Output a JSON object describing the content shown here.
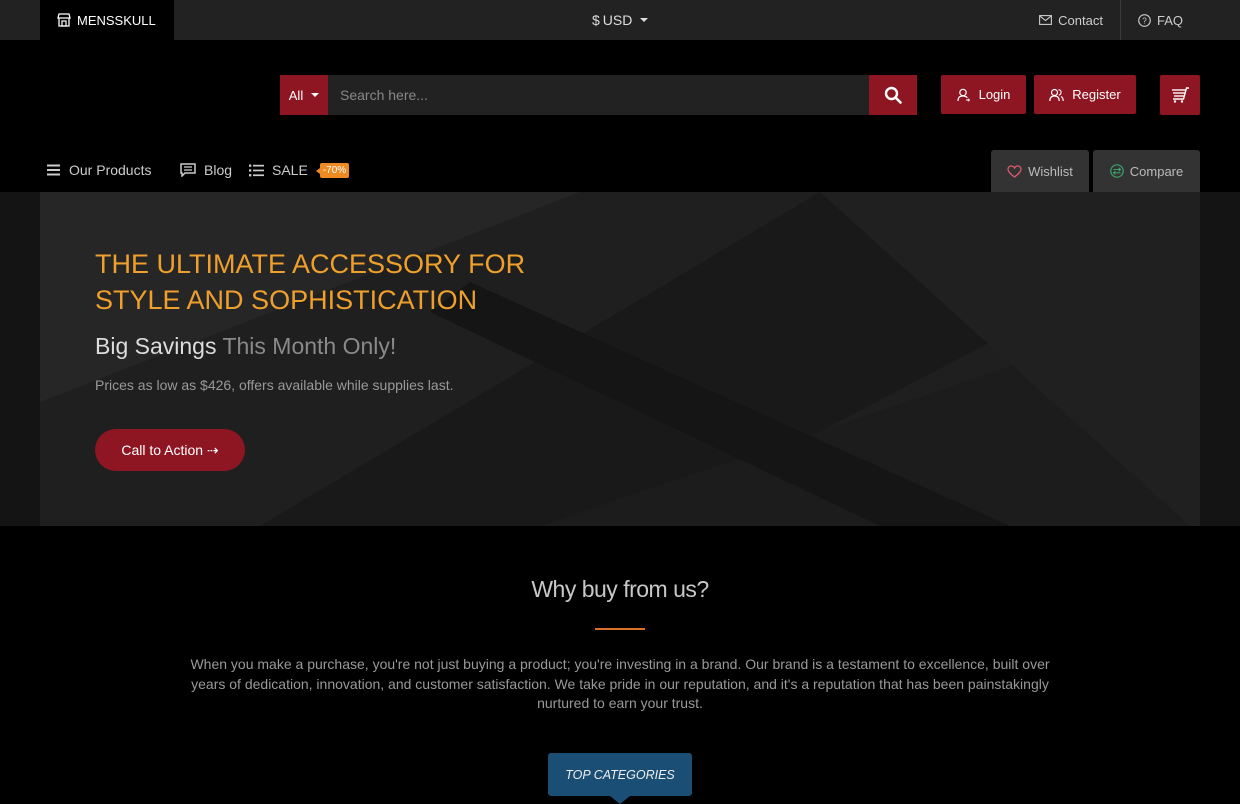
{
  "topbar": {
    "store_name": "MENSSKULL",
    "currency_symbol": "$",
    "currency_code": "USD",
    "links": [
      "Contact",
      "FAQ"
    ]
  },
  "search": {
    "category": "All",
    "placeholder": "Search here..."
  },
  "account": {
    "login_label": "Login",
    "register_label": "Register"
  },
  "nav": {
    "products_label": "Our Products",
    "blog_label": "Blog",
    "sale_label": "SALE",
    "sale_badge": "-70%",
    "wishlist_label": "Wishlist",
    "compare_label": "Compare"
  },
  "hero": {
    "title": "THE ULTIMATE ACCESSORY FOR STYLE AND SOPHISTICATION",
    "subtitle_main": "Big Savings",
    "subtitle_muted": "This Month Only!",
    "description": "Prices as low as $426, offers available while supplies last.",
    "cta_label": "Call to Action ⇢"
  },
  "why": {
    "title": "Why buy from us?",
    "text": "When you make a purchase, you're not just buying a product; you're investing in a brand. Our brand is a testament to excellence, built over years of dedication, innovation, and customer satisfaction. We take pride in our reputation, and it's a reputation that has been painstakingly nurtured to earn your trust."
  },
  "top_categories_label": "TOP CATEGORIES",
  "colors": {
    "accent_red": "#8e1623",
    "accent_orange": "#ee9f2c",
    "badge_orange": "#ee8a22",
    "category_blue": "#1b4e75"
  },
  "icons": [
    "store-icon",
    "mail-icon",
    "question-icon",
    "search-icon",
    "user-icon",
    "users-icon",
    "cart-icon",
    "menu-icon",
    "blog-icon",
    "list-icon",
    "heart-icon",
    "compare-icon"
  ]
}
